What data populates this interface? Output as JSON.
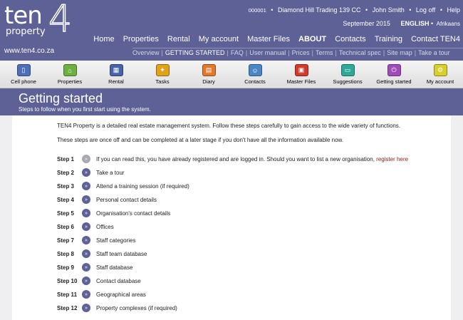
{
  "logo": {
    "word": "ten",
    "sub": "property",
    "digit": "4"
  },
  "site_url": "www.ten4.co.za",
  "account": {
    "number": "000001",
    "company": "Diamond Hill Trading 139 CC",
    "user": "John Smith",
    "logoff": "Log off",
    "help": "Help",
    "bullet": "•"
  },
  "date_lang": {
    "date": "September 2015",
    "english": "ENGLISH",
    "afrikaans": "Afrikaans",
    "bullet": "•"
  },
  "main_nav": [
    "Home",
    "Properties",
    "Rental",
    "My account",
    "Master Files",
    "ABOUT",
    "Contacts",
    "Training",
    "Contact TEN4"
  ],
  "sub_nav": [
    "Overview",
    "GETTING STARTED",
    "FAQ",
    "User manual",
    "Prices",
    "Terms",
    "Technical spec",
    "Site map",
    "Take a tour"
  ],
  "toolbar": [
    {
      "label": "Cell phone",
      "icon": "cell-phone-icon",
      "color": "#4c6fb8",
      "glyph": "▯"
    },
    {
      "label": "Properties",
      "icon": "house-icon",
      "color": "#6bb041",
      "glyph": "⌂"
    },
    {
      "label": "Rental",
      "icon": "grid-icon",
      "color": "#4a63a8",
      "glyph": "▦"
    },
    {
      "label": "Tasks",
      "icon": "pin-icon",
      "color": "#e0a21a",
      "glyph": "✦"
    },
    {
      "label": "Diary",
      "icon": "calendar-icon",
      "color": "#e07a2a",
      "glyph": "▤"
    },
    {
      "label": "Contacts",
      "icon": "person-icon",
      "color": "#4a86c4",
      "glyph": "☺"
    },
    {
      "label": "Master Files",
      "icon": "files-icon",
      "color": "#d23a2a",
      "glyph": "▣"
    },
    {
      "label": "Suggestions",
      "icon": "monitor-icon",
      "color": "#2fa89a",
      "glyph": "▭"
    },
    {
      "label": "Getting started",
      "icon": "power-icon",
      "color": "#a04cb8",
      "glyph": "⏻"
    },
    {
      "label": "My account",
      "icon": "gear-icon",
      "color": "#d8cf2a",
      "glyph": "⚙"
    }
  ],
  "page": {
    "title": "Getting started",
    "subtitle": "Steps to follow when you first start using the system."
  },
  "intro": [
    "TEN4 Property is a detailed real estate management system. Follow these steps carefully to gain access to the wide variety of functions.",
    "These steps are once off and can be completed at a later stage if you don't have all the information available now."
  ],
  "steps": [
    {
      "num": "Step 1",
      "text": "If you can read this, you have already registered and are logged in. Should you want to list a new organisation,",
      "link": "register here",
      "done": true
    },
    {
      "num": "Step 2",
      "text": "Take a tour"
    },
    {
      "num": "Step 3",
      "text": "Attend a training session (if required)"
    },
    {
      "num": "Step 4",
      "text": "Personal contact details"
    },
    {
      "num": "Step 5",
      "text": "Organisation's contact details"
    },
    {
      "num": "Step 6",
      "text": "Offices"
    },
    {
      "num": "Step 7",
      "text": "Staff categories"
    },
    {
      "num": "Step 8",
      "text": "Staff team database"
    },
    {
      "num": "Step 9",
      "text": "Staff database"
    },
    {
      "num": "Step 10",
      "text": "Contact database"
    },
    {
      "num": "Step 11",
      "text": "Geographical areas"
    },
    {
      "num": "Step 12",
      "text": "Property complexes (if required)"
    }
  ],
  "colors": {
    "header": "#5d6196",
    "link": "#8b1a1a"
  }
}
